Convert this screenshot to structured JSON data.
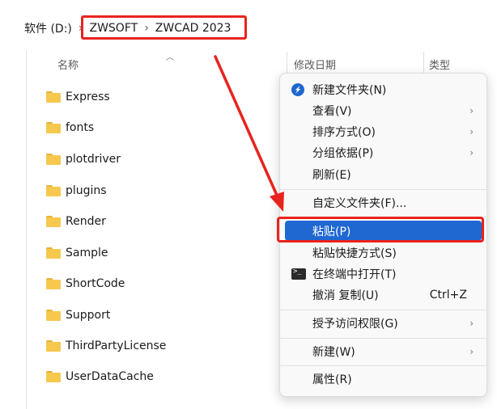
{
  "breadcrumb": {
    "drive": "软件 (D:)",
    "folder1": "ZWSOFT",
    "folder2": "ZWCAD 2023"
  },
  "columns": {
    "name": "名称",
    "modified": "修改日期",
    "type": "类型"
  },
  "files": [
    {
      "name": "Express"
    },
    {
      "name": "fonts"
    },
    {
      "name": "plotdriver"
    },
    {
      "name": "plugins"
    },
    {
      "name": "Render"
    },
    {
      "name": "Sample"
    },
    {
      "name": "ShortCode"
    },
    {
      "name": "Support"
    },
    {
      "name": "ThirdPartyLicense"
    },
    {
      "name": "UserDataCache"
    }
  ],
  "context_menu": {
    "new_folder": "新建文件夹(N)",
    "view": "查看(V)",
    "sort_by": "排序方式(O)",
    "group_by": "分组依据(P)",
    "refresh": "刷新(E)",
    "customize_folder": "自定义文件夹(F)...",
    "paste": "粘贴(P)",
    "paste_shortcut": "粘贴快捷方式(S)",
    "open_in_terminal": "在终端中打开(T)",
    "undo_copy": "撤消 复制(U)",
    "undo_shortcut": "Ctrl+Z",
    "grant_access": "授予访问权限(G)",
    "new": "新建(W)",
    "properties": "属性(R)"
  },
  "icons": {
    "folder": "folder-icon",
    "new_folder": "new-folder-icon",
    "terminal": "terminal-icon",
    "chevron": "chevron-right-icon"
  },
  "colors": {
    "highlight": "#e8231e",
    "menu_active": "#1f68d2",
    "folder": "#f6c84e"
  }
}
